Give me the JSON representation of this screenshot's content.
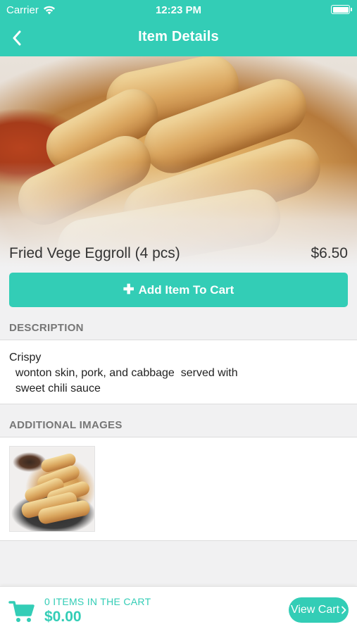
{
  "status_bar": {
    "carrier": "Carrier",
    "time": "12:23 PM"
  },
  "nav": {
    "title": "Item Details"
  },
  "product": {
    "name": "Fried Vege Eggroll (4 pcs)",
    "price": "$6.50",
    "add_button_label": "Add Item To Cart"
  },
  "description": {
    "header": "DESCRIPTION",
    "text": "Crispy\n  wonton skin, pork, and cabbage  served with\n  sweet chili sauce"
  },
  "additional_images": {
    "header": "ADDITIONAL IMAGES"
  },
  "cart": {
    "count_label": "0 ITEMS IN THE CART",
    "total": "$0.00",
    "view_cart_label": "View Cart",
    "view_cart_icon": "chevron-right-icon"
  },
  "colors": {
    "accent": "#33cdb6",
    "background": "#f1f1f2",
    "section_header_text": "#767676"
  }
}
